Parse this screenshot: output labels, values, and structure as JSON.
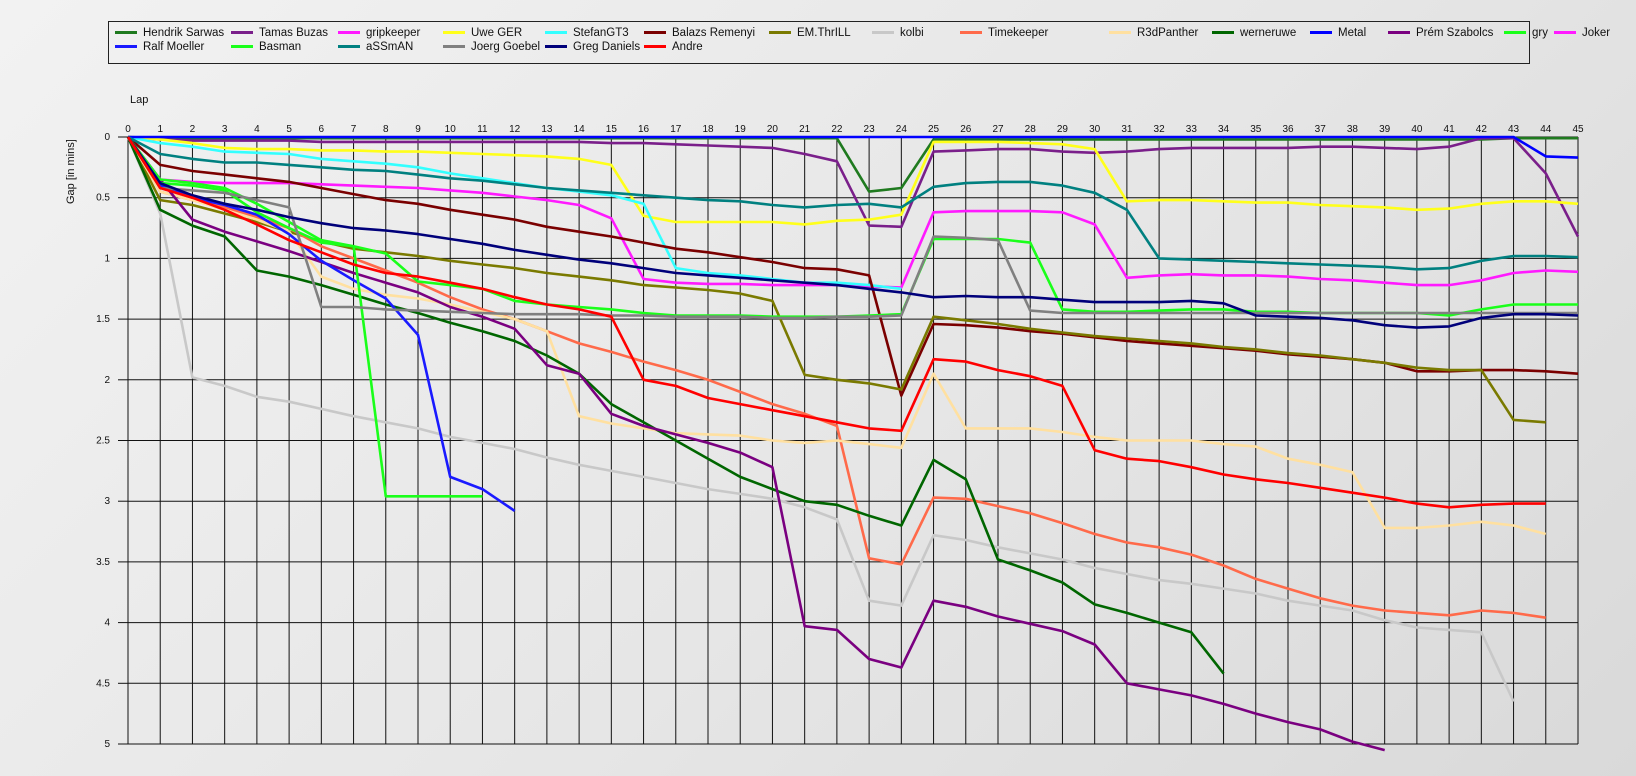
{
  "chart_data": {
    "type": "line",
    "xlabel": "Lap",
    "ylabel": "Gap [in mins]",
    "x_ticks": [
      0,
      1,
      2,
      3,
      4,
      5,
      6,
      7,
      8,
      9,
      10,
      11,
      12,
      13,
      14,
      15,
      16,
      17,
      18,
      19,
      20,
      21,
      22,
      23,
      24,
      25,
      26,
      27,
      28,
      29,
      30,
      31,
      32,
      33,
      34,
      35,
      36,
      37,
      38,
      39,
      40,
      41,
      42,
      43,
      44,
      45
    ],
    "y_ticks": [
      "0",
      "0.5",
      "1",
      "1.5",
      "2",
      "2.5",
      "3",
      "3.5",
      "4",
      "4.5",
      "5"
    ],
    "ylim": [
      0,
      5
    ],
    "xlim": [
      0,
      45
    ],
    "y_inverted": true,
    "grid": true,
    "legend_position": "top",
    "series": [
      {
        "name": "Hendrik Sarwas",
        "color": "#1f7a1f",
        "values": [
          0,
          0.01,
          0.01,
          0.01,
          0.01,
          0.01,
          0.01,
          0.01,
          0.01,
          0.01,
          0.01,
          0.01,
          0.01,
          0.01,
          0.01,
          0.01,
          0.01,
          0.01,
          0.01,
          0.01,
          0.01,
          0.01,
          0.01,
          0.45,
          0.42,
          0.02,
          0.02,
          0.02,
          0.02,
          0.02,
          0.02,
          0.02,
          0.02,
          0.02,
          0.02,
          0.02,
          0.02,
          0.02,
          0.02,
          0.02,
          0.02,
          0.02,
          0.02,
          0.01,
          0.01,
          0.01
        ]
      },
      {
        "name": "Tamas Buzas",
        "color": "#7a1f8a",
        "values": [
          0,
          0.02,
          0.03,
          0.03,
          0.03,
          0.03,
          0.04,
          0.04,
          0.04,
          0.04,
          0.04,
          0.04,
          0.04,
          0.04,
          0.04,
          0.05,
          0.05,
          0.06,
          0.07,
          0.08,
          0.09,
          0.14,
          0.2,
          0.73,
          0.74,
          0.12,
          0.11,
          0.1,
          0.1,
          0.12,
          0.13,
          0.12,
          0.1,
          0.09,
          0.09,
          0.09,
          0.09,
          0.08,
          0.08,
          0.09,
          0.1,
          0.08,
          0.01,
          0.01,
          0.3,
          0.82
        ]
      },
      {
        "name": "gripkeeper",
        "color": "#ff1aff",
        "values": [
          0,
          0.35,
          0.37,
          0.38,
          0.38,
          0.38,
          0.39,
          0.4,
          0.41,
          0.42,
          0.44,
          0.46,
          0.49,
          0.52,
          0.56,
          0.67,
          1.17,
          1.2,
          1.21,
          1.21,
          1.22,
          1.22,
          1.22,
          1.23,
          1.24,
          0.62,
          0.61,
          0.61,
          0.61,
          0.62,
          0.72,
          1.16,
          1.14,
          1.13,
          1.14,
          1.14,
          1.15,
          1.17,
          1.18,
          1.2,
          1.22,
          1.22,
          1.18,
          1.12,
          1.1,
          1.11
        ]
      },
      {
        "name": "Uwe GER",
        "color": "#ffff1a",
        "values": [
          0,
          0.02,
          0.05,
          0.09,
          0.1,
          0.1,
          0.11,
          0.11,
          0.12,
          0.12,
          0.13,
          0.14,
          0.15,
          0.16,
          0.18,
          0.23,
          0.65,
          0.7,
          0.7,
          0.7,
          0.7,
          0.72,
          0.69,
          0.68,
          0.64,
          0.04,
          0.04,
          0.04,
          0.05,
          0.06,
          0.1,
          0.53,
          0.52,
          0.52,
          0.53,
          0.54,
          0.54,
          0.56,
          0.57,
          0.58,
          0.6,
          0.59,
          0.55,
          0.53,
          0.53,
          0.55
        ]
      },
      {
        "name": "StefanGT3",
        "color": "#33ffff",
        "values": [
          0,
          0.05,
          0.08,
          0.12,
          0.13,
          0.14,
          0.18,
          0.2,
          0.22,
          0.25,
          0.3,
          0.34,
          0.38,
          0.42,
          0.45,
          0.48,
          0.55,
          1.08,
          1.12,
          1.14,
          1.17,
          1.2,
          1.2,
          1.22,
          1.25
        ]
      },
      {
        "name": "Balazs Remenyi",
        "color": "#7a0000",
        "values": [
          0,
          0.23,
          0.28,
          0.31,
          0.34,
          0.37,
          0.42,
          0.47,
          0.52,
          0.55,
          0.6,
          0.64,
          0.68,
          0.74,
          0.78,
          0.82,
          0.87,
          0.92,
          0.95,
          0.99,
          1.03,
          1.08,
          1.09,
          1.14,
          2.13,
          1.54,
          1.55,
          1.57,
          1.6,
          1.62,
          1.65,
          1.68,
          1.7,
          1.72,
          1.74,
          1.76,
          1.79,
          1.81,
          1.83,
          1.86,
          1.93,
          1.93,
          1.92,
          1.92,
          1.93,
          1.95
        ]
      },
      {
        "name": "EM.ThrILL",
        "color": "#7a7a00",
        "values": [
          0,
          0.52,
          0.56,
          0.63,
          0.7,
          0.78,
          0.86,
          0.92,
          0.95,
          0.98,
          1.02,
          1.05,
          1.08,
          1.12,
          1.15,
          1.18,
          1.22,
          1.24,
          1.26,
          1.29,
          1.35,
          1.96,
          2.0,
          2.03,
          2.08,
          1.48,
          1.51,
          1.54,
          1.58,
          1.61,
          1.64,
          1.66,
          1.68,
          1.7,
          1.73,
          1.75,
          1.78,
          1.8,
          1.83,
          1.86,
          1.9,
          1.92,
          1.92,
          2.33,
          2.35
        ]
      },
      {
        "name": "kolbi",
        "color": "#c8c8c8",
        "values": [
          0,
          0.63,
          1.98,
          2.05,
          2.14,
          2.18,
          2.24,
          2.3,
          2.35,
          2.4,
          2.47,
          2.52,
          2.57,
          2.64,
          2.7,
          2.75,
          2.8,
          2.85,
          2.9,
          2.94,
          2.98,
          3.05,
          3.15,
          3.82,
          3.86,
          3.28,
          3.32,
          3.38,
          3.43,
          3.48,
          3.55,
          3.6,
          3.65,
          3.68,
          3.72,
          3.76,
          3.82,
          3.86,
          3.9,
          3.98,
          4.04,
          4.06,
          4.08,
          4.65
        ]
      },
      {
        "name": "Timekeeper",
        "color": "#ff6a4a",
        "values": [
          0,
          0.45,
          0.52,
          0.58,
          0.66,
          0.75,
          0.9,
          1.0,
          1.1,
          1.2,
          1.32,
          1.42,
          1.5,
          1.6,
          1.7,
          1.77,
          1.85,
          1.92,
          2.0,
          2.1,
          2.2,
          2.28,
          2.38,
          3.47,
          3.52,
          2.97,
          2.98,
          3.04,
          3.1,
          3.18,
          3.27,
          3.34,
          3.38,
          3.44,
          3.53,
          3.64,
          3.72,
          3.8,
          3.86,
          3.9,
          3.92,
          3.94,
          3.9,
          3.92,
          3.96
        ]
      },
      {
        "name": "R3dPanther",
        "color": "#ffe0a0",
        "values": [
          0,
          0.45,
          0.52,
          0.6,
          0.68,
          0.78,
          1.15,
          1.25,
          1.3,
          1.33,
          1.38,
          1.44,
          1.5,
          1.6,
          2.3,
          2.36,
          2.4,
          2.44,
          2.45,
          2.46,
          2.5,
          2.52,
          2.5,
          2.53,
          2.56,
          1.95,
          2.4,
          2.4,
          2.4,
          2.43,
          2.47,
          2.5,
          2.5,
          2.5,
          2.53,
          2.55,
          2.65,
          2.7,
          2.76,
          3.22,
          3.22,
          3.2,
          3.17,
          3.2,
          3.27
        ]
      },
      {
        "name": "werneruwe",
        "color": "#006600",
        "values": [
          0,
          0.6,
          0.73,
          0.82,
          1.1,
          1.15,
          1.22,
          1.3,
          1.38,
          1.45,
          1.53,
          1.6,
          1.68,
          1.8,
          1.95,
          2.2,
          2.35,
          2.5,
          2.65,
          2.8,
          2.9,
          3.0,
          3.03,
          3.12,
          3.2,
          2.66,
          2.82,
          3.48,
          3.57,
          3.67,
          3.85,
          3.92,
          4.0,
          4.08,
          4.42
        ]
      },
      {
        "name": "Metal",
        "color": "#0000ff",
        "values": [
          0,
          0,
          0,
          0,
          0,
          0,
          0,
          0,
          0,
          0,
          0,
          0,
          0,
          0,
          0,
          0,
          0,
          0,
          0,
          0,
          0,
          0,
          0,
          0,
          0,
          0,
          0,
          0,
          0,
          0,
          0,
          0,
          0,
          0,
          0,
          0,
          0,
          0,
          0,
          0,
          0,
          0,
          0,
          0,
          0.16,
          0.17
        ]
      },
      {
        "name": "Prém Szabolcs",
        "color": "#7a0080",
        "values": [
          0,
          0.35,
          0.68,
          0.78,
          0.86,
          0.94,
          1.03,
          1.12,
          1.2,
          1.28,
          1.4,
          1.48,
          1.58,
          1.88,
          1.95,
          2.28,
          2.38,
          2.45,
          2.52,
          2.6,
          2.72,
          4.03,
          4.06,
          4.3,
          4.37,
          3.82,
          3.87,
          3.95,
          4.01,
          4.07,
          4.18,
          4.5,
          4.55,
          4.6,
          4.67,
          4.75,
          4.82,
          4.88,
          4.98,
          5.05
        ]
      },
      {
        "name": "gry",
        "color": "#1aff1a",
        "values": [
          0,
          0.35,
          0.38,
          0.42,
          0.55,
          0.7,
          0.85,
          0.9,
          0.96,
          1.19,
          1.22,
          1.25,
          1.35,
          1.38,
          1.4,
          1.42,
          1.45,
          1.47,
          1.47,
          1.47,
          1.48,
          1.48,
          1.48,
          1.47,
          1.46,
          0.84,
          0.84,
          0.84,
          0.87,
          1.42,
          1.44,
          1.44,
          1.43,
          1.42,
          1.42,
          1.44,
          1.44,
          1.45,
          1.45,
          1.45,
          1.45,
          1.47,
          1.42,
          1.38,
          1.38,
          1.38
        ]
      },
      {
        "name": "Joker",
        "color": "#ff1aff",
        "values": []
      },
      {
        "name": "Ralf Moeller",
        "color": "#1a1aff",
        "values": [
          0,
          0.4,
          0.5,
          0.56,
          0.64,
          0.8,
          1.02,
          1.18,
          1.33,
          1.63,
          2.8,
          2.9,
          3.08
        ]
      },
      {
        "name": "Basman",
        "color": "#1aff1a",
        "values": [
          0,
          0.38,
          0.4,
          0.44,
          0.62,
          0.75,
          0.87,
          0.9,
          2.96,
          2.96,
          2.96,
          2.96
        ]
      },
      {
        "name": "aSSmAN",
        "color": "#008080",
        "values": [
          0,
          0.14,
          0.18,
          0.21,
          0.21,
          0.23,
          0.25,
          0.27,
          0.28,
          0.31,
          0.34,
          0.36,
          0.39,
          0.42,
          0.44,
          0.46,
          0.48,
          0.5,
          0.52,
          0.53,
          0.56,
          0.58,
          0.56,
          0.55,
          0.58,
          0.41,
          0.38,
          0.37,
          0.37,
          0.4,
          0.46,
          0.6,
          1.0,
          1.01,
          1.02,
          1.03,
          1.04,
          1.05,
          1.06,
          1.07,
          1.09,
          1.08,
          1.02,
          0.98,
          0.98,
          0.99
        ]
      },
      {
        "name": "Joerg Goebel",
        "color": "#808080",
        "values": [
          0,
          0.42,
          0.44,
          0.46,
          0.52,
          0.58,
          1.4,
          1.4,
          1.42,
          1.43,
          1.44,
          1.45,
          1.46,
          1.46,
          1.46,
          1.47,
          1.47,
          1.48,
          1.48,
          1.48,
          1.49,
          1.49,
          1.48,
          1.48,
          1.47,
          0.82,
          0.83,
          0.85,
          1.43,
          1.45,
          1.45,
          1.45,
          1.45,
          1.45,
          1.45,
          1.45,
          1.45,
          1.45,
          1.45,
          1.45,
          1.45,
          1.45,
          1.45,
          1.45,
          1.45,
          1.45
        ]
      },
      {
        "name": "Greg Daniels",
        "color": "#00007a",
        "values": [
          0,
          0.38,
          0.48,
          0.55,
          0.6,
          0.66,
          0.71,
          0.75,
          0.77,
          0.8,
          0.84,
          0.88,
          0.93,
          0.97,
          1.01,
          1.04,
          1.08,
          1.12,
          1.14,
          1.16,
          1.18,
          1.2,
          1.22,
          1.25,
          1.28,
          1.32,
          1.31,
          1.32,
          1.32,
          1.34,
          1.36,
          1.36,
          1.36,
          1.35,
          1.37,
          1.47,
          1.48,
          1.49,
          1.51,
          1.55,
          1.57,
          1.56,
          1.49,
          1.46,
          1.46,
          1.47
        ]
      },
      {
        "name": "Andre",
        "color": "#ff0000",
        "values": [
          0,
          0.42,
          0.5,
          0.6,
          0.72,
          0.85,
          0.95,
          1.05,
          1.12,
          1.15,
          1.2,
          1.25,
          1.32,
          1.38,
          1.42,
          1.48,
          2.0,
          2.05,
          2.15,
          2.2,
          2.25,
          2.3,
          2.35,
          2.4,
          2.42,
          1.83,
          1.85,
          1.92,
          1.97,
          2.05,
          2.58,
          2.65,
          2.67,
          2.72,
          2.78,
          2.82,
          2.85,
          2.89,
          2.93,
          2.97,
          3.02,
          3.05,
          3.03,
          3.02,
          3.02
        ]
      }
    ]
  }
}
